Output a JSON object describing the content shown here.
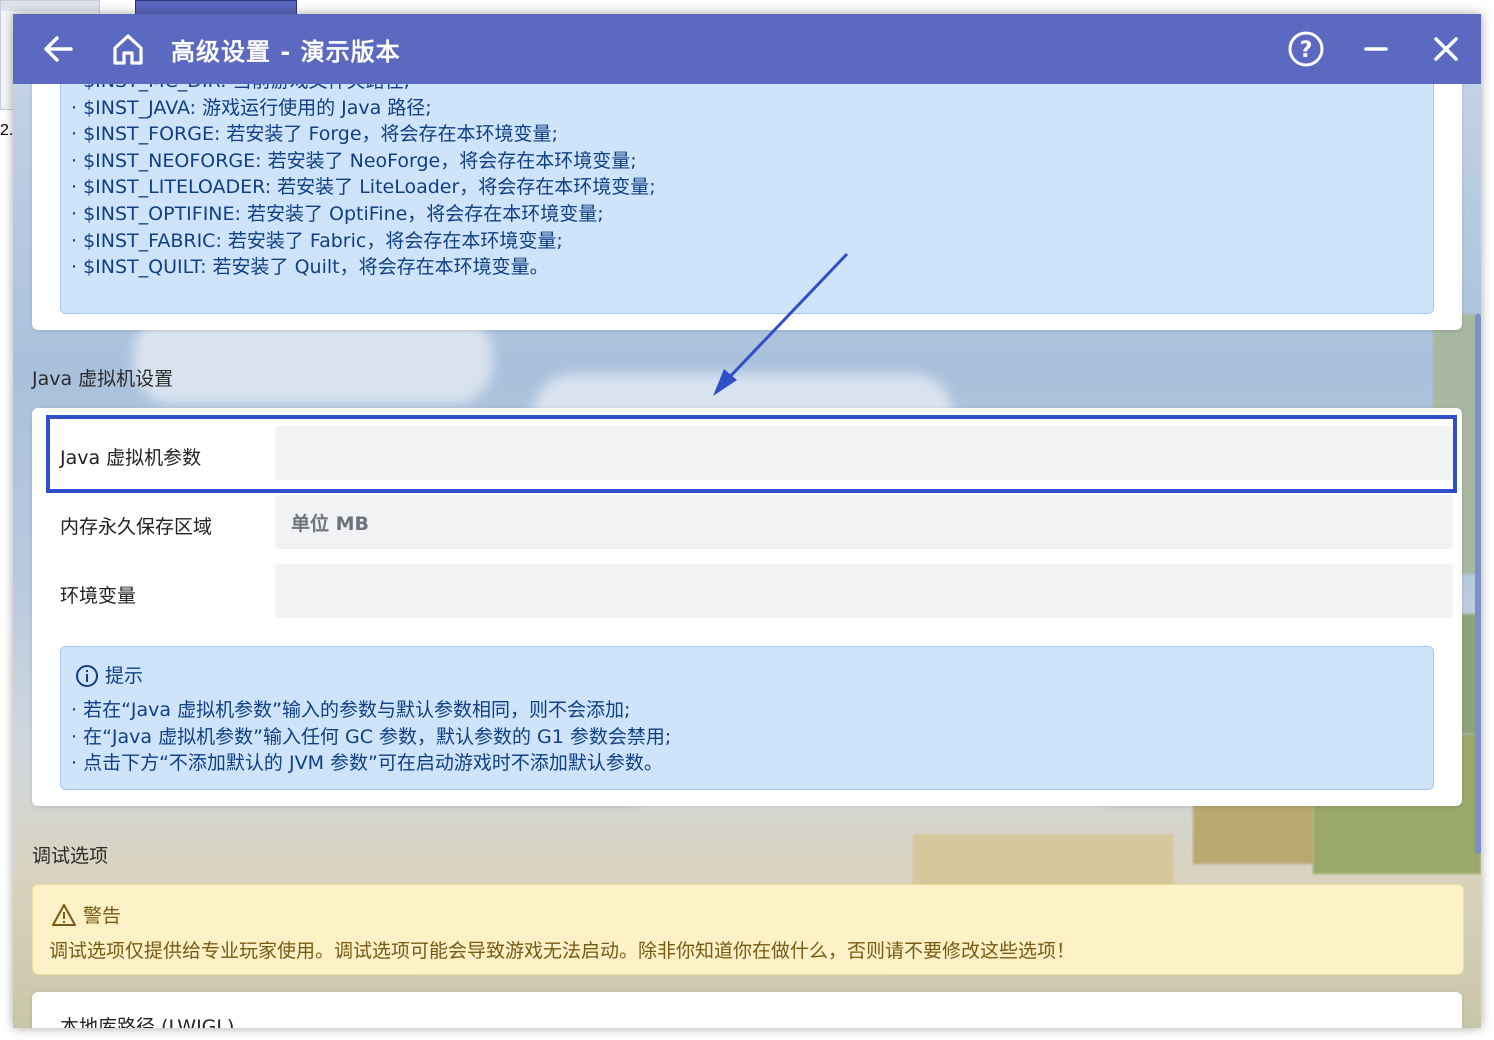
{
  "window": {
    "title": "高级设置 - 演示版本",
    "buttons": [
      "back-icon",
      "home-icon",
      "help-icon",
      "minimize-icon",
      "close-icon"
    ]
  },
  "background": {
    "number_fragment": "2."
  },
  "env_vars": {
    "lines": [
      "· $INST_MC_DIR: 当前游戏文件夹路径;",
      "· $INST_JAVA: 游戏运行使用的 Java 路径;",
      "· $INST_FORGE: 若安装了 Forge，将会存在本环境变量;",
      "· $INST_NEOFORGE: 若安装了 NeoForge，将会存在本环境变量;",
      "· $INST_LITELOADER: 若安装了 LiteLoader，将会存在本环境变量;",
      "· $INST_OPTIFINE: 若安装了 OptiFine，将会存在本环境变量;",
      "· $INST_FABRIC: 若安装了 Fabric，将会存在本环境变量;",
      "· $INST_QUILT: 若安装了 Quilt，将会存在本环境变量。"
    ]
  },
  "jvm_section": {
    "title": "Java 虚拟机设置",
    "rows": [
      {
        "label": "Java 虚拟机参数",
        "value": "",
        "placeholder": ""
      },
      {
        "label": "内存永久保存区域",
        "value": "",
        "placeholder": "单位 MB"
      },
      {
        "label": "环境变量",
        "value": "",
        "placeholder": ""
      }
    ],
    "tip": {
      "title": "提示",
      "lines": [
        "· 若在“Java 虚拟机参数”输入的参数与默认参数相同，则不会添加;",
        "· 在“Java 虚拟机参数”输入任何 GC 参数，默认参数的 G1 参数会禁用;",
        "· 点击下方“不添加默认的 JVM 参数”可在启动游戏时不添加默认参数。"
      ]
    }
  },
  "debug_section": {
    "title": "调试选项",
    "warning": {
      "title": "警告",
      "text": "调试选项仅提供给专业玩家使用。调试选项可能会导致游戏无法启动。除非你知道你在做什么，否则请不要修改这些选项！"
    },
    "next_row_label": "本地库路径 (LWJGL)"
  },
  "colors": {
    "titlebar": "#5b69c0",
    "info_bg": "#cfe4fb",
    "info_text": "#0f3f85",
    "warning_bg": "#fdf1c8",
    "highlight": "#2f4fc8"
  }
}
